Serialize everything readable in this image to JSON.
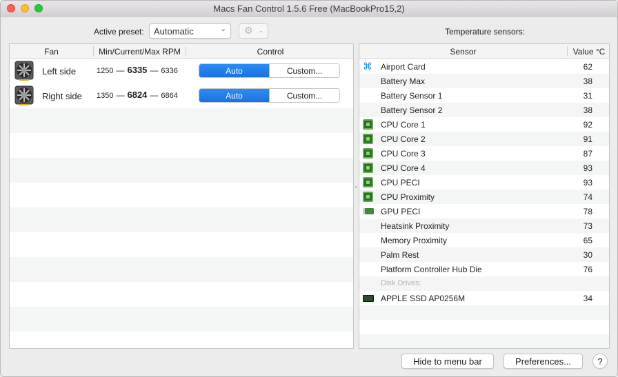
{
  "window": {
    "title": "Macs Fan Control 1.5.6 Free (MacBookPro15,2)"
  },
  "preset": {
    "label": "Active preset:",
    "value": "Automatic"
  },
  "fans": {
    "columns": {
      "fan": "Fan",
      "rpm": "Min/Current/Max RPM",
      "control": "Control"
    },
    "rows": [
      {
        "name": "Left side",
        "min": "1250",
        "current": "6335",
        "max": "6336",
        "mode": "Auto",
        "custom": "Custom..."
      },
      {
        "name": "Right side",
        "min": "1350",
        "current": "6824",
        "max": "6864",
        "mode": "Auto",
        "custom": "Custom..."
      }
    ],
    "separator": "—"
  },
  "sensors": {
    "heading": "Temperature sensors:",
    "columns": {
      "sensor": "Sensor",
      "value": "Value °C"
    },
    "rows": [
      {
        "name": "Airport Card",
        "value": "62",
        "icon": "wifi-icon"
      },
      {
        "name": "Battery Max",
        "value": "38",
        "icon": ""
      },
      {
        "name": "Battery Sensor 1",
        "value": "31",
        "icon": ""
      },
      {
        "name": "Battery Sensor 2",
        "value": "38",
        "icon": ""
      },
      {
        "name": "CPU Core 1",
        "value": "92",
        "icon": "cpu-chip-icon"
      },
      {
        "name": "CPU Core 2",
        "value": "91",
        "icon": "cpu-chip-icon"
      },
      {
        "name": "CPU Core 3",
        "value": "87",
        "icon": "cpu-chip-icon"
      },
      {
        "name": "CPU Core 4",
        "value": "93",
        "icon": "cpu-chip-icon"
      },
      {
        "name": "CPU PECI",
        "value": "93",
        "icon": "cpu-chip-icon"
      },
      {
        "name": "CPU Proximity",
        "value": "74",
        "icon": "cpu-chip-icon"
      },
      {
        "name": "GPU PECI",
        "value": "78",
        "icon": "gpu-card-icon"
      },
      {
        "name": "Heatsink Proximity",
        "value": "73",
        "icon": ""
      },
      {
        "name": "Memory Proximity",
        "value": "65",
        "icon": ""
      },
      {
        "name": "Palm Rest",
        "value": "30",
        "icon": ""
      },
      {
        "name": "Platform Controller Hub Die",
        "value": "76",
        "icon": ""
      },
      {
        "name": "Disk Drives:",
        "value": "",
        "icon": "",
        "group": true
      },
      {
        "name": "APPLE SSD AP0256M",
        "value": "34",
        "icon": "ssd-drive-icon"
      }
    ]
  },
  "buttons": {
    "hide": "Hide to menu bar",
    "preferences": "Preferences...",
    "help": "?"
  },
  "colors": {
    "accent": "#1a72e0",
    "chip_green": "#5fae4a"
  }
}
